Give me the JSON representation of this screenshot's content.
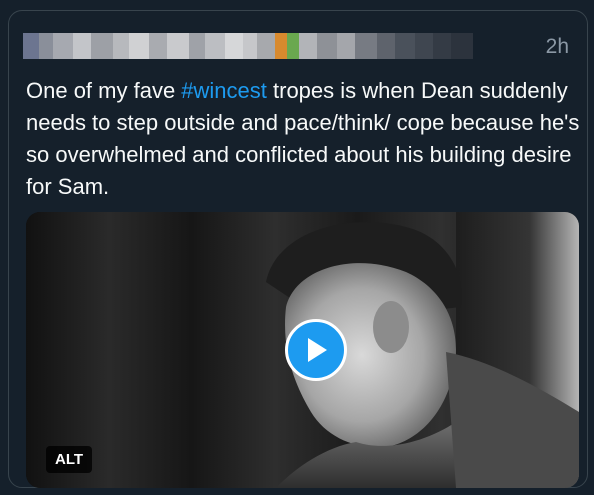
{
  "tweet": {
    "timestamp": "2h",
    "text_before": "One of my fave ",
    "hashtag": "#wincest",
    "text_after": " tropes is when Dean suddenly needs to step outside and pace/think/ cope because he's so overwhelmed and conflicted about his building desire for Sam.",
    "media": {
      "alt_label": "ALT",
      "play_icon": "play-icon"
    }
  },
  "colors": {
    "background": "#15202b",
    "text": "#f7f9f9",
    "muted": "#8b98a5",
    "accent": "#1d9bf0",
    "border": "#38444d"
  }
}
